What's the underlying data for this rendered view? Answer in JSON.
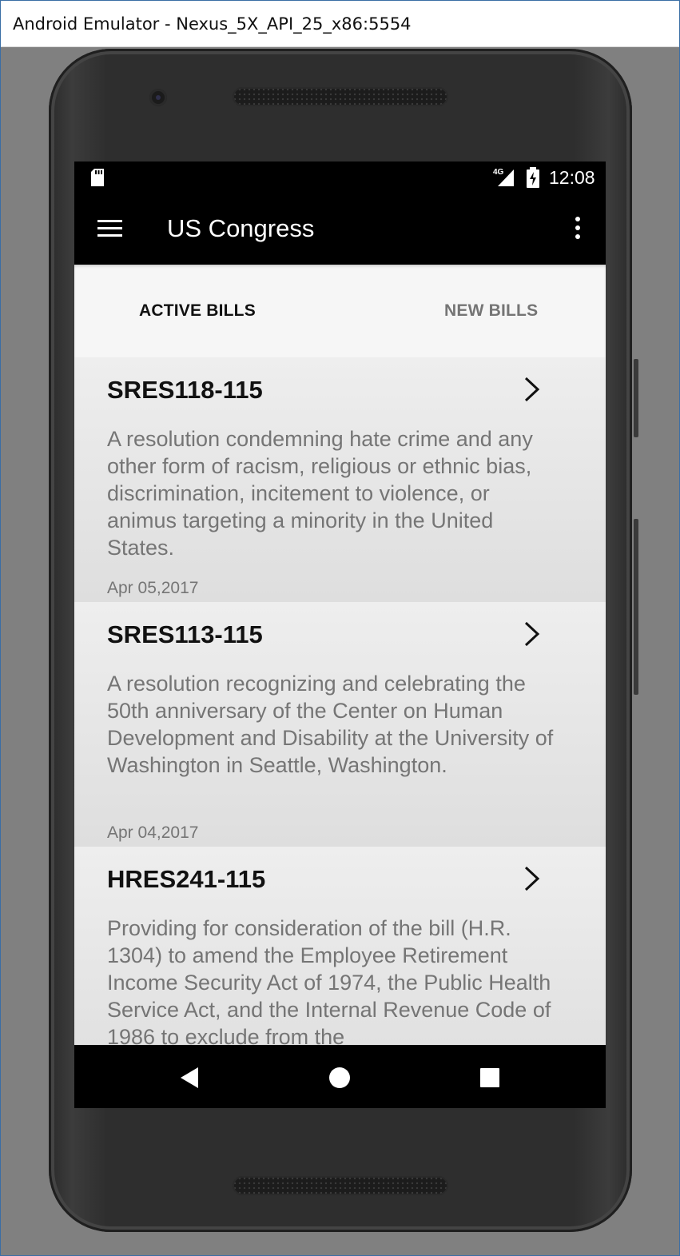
{
  "window": {
    "title": "Android Emulator - Nexus_5X_API_25_x86:5554"
  },
  "status_bar": {
    "time": "12:08",
    "network": "4G",
    "icons": [
      "sd-card-icon",
      "signal-4g-icon",
      "battery-charging-icon"
    ]
  },
  "app_bar": {
    "title": "US Congress",
    "icons": [
      "menu-icon",
      "more-vert-icon"
    ]
  },
  "tabs": [
    {
      "label": "ACTIVE BILLS",
      "active": true
    },
    {
      "label": "NEW BILLS",
      "active": false
    }
  ],
  "bills": [
    {
      "id": "SRES118-115",
      "description": "A resolution condemning hate crime and any other form of racism, religious or ethnic bias, discrimination, incitement to violence, or animus targeting a minority in the United States.",
      "date": "Apr 05,2017"
    },
    {
      "id": "SRES113-115",
      "description": "A resolution recognizing and celebrating the 50th anniversary of the Center on Human Development and Disability at the University of Washington in Seattle, Washington.",
      "date": "Apr 04,2017"
    },
    {
      "id": "HRES241-115",
      "description": "Providing for consideration of the bill (H.R. 1304) to amend the Employee Retirement Income Security Act of 1974, the Public Health Service Act, and the Internal Revenue Code of 1986 to exclude from the",
      "date": ""
    }
  ],
  "nav_bar": {
    "icons": [
      "back-icon",
      "home-icon",
      "recents-icon"
    ]
  }
}
